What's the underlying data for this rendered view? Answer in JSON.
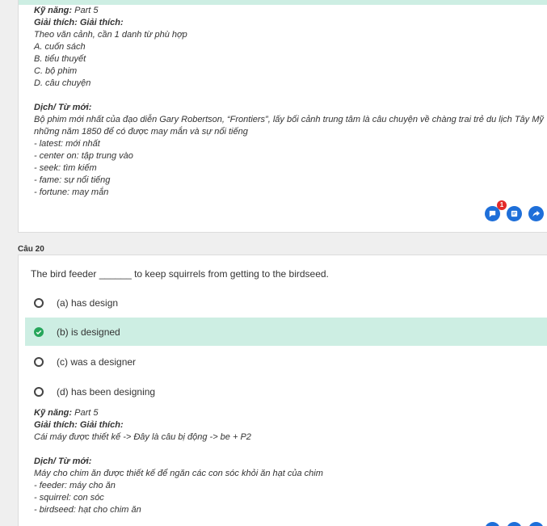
{
  "prev_question": {
    "explanation": {
      "skill_label": "Kỹ năng:",
      "skill_value": " Part 5",
      "reason_label": "Giải thích: Giải thích:",
      "lines": [
        "Theo văn cảnh, cần 1 danh từ phù hợp",
        "A. cuốn sách",
        "B. tiểu thuyết",
        "C. bộ phim",
        "D. câu chuyện"
      ],
      "translation_label": "Dịch/ Từ mới:",
      "translation": "Bộ phim mới nhất của đạo diễn Gary Robertson, “Frontiers”, lấy bối cảnh trung tâm là câu chuyện về chàng trai trẻ du lịch Tây Mỹ những năm 1850 để có được may mắn và sự nổi tiếng",
      "vocab": [
        "- latest: mới nhất",
        "- center on: tập trung vào",
        "- seek: tìm kiếm",
        "- fame: sự nổi tiếng",
        "- fortune: may mắn"
      ]
    },
    "comment_badge": "1"
  },
  "question": {
    "label": "Câu 20",
    "text": "The bird feeder ______ to keep squirrels from getting to the birdseed.",
    "options": [
      {
        "text": "(a) has design",
        "selected": false
      },
      {
        "text": "(b) is designed",
        "selected": true
      },
      {
        "text": "(c) was a designer",
        "selected": false
      },
      {
        "text": "(d) has been designing",
        "selected": false
      }
    ],
    "explanation": {
      "skill_label": "Kỹ năng:",
      "skill_value": " Part 5",
      "reason_label": "Giải thích: Giải thích:",
      "reason": "Cái máy được thiết kế -> Đây là câu bị động -> be + P2",
      "translation_label": "Dịch/ Từ mới:",
      "translation": "Máy cho chim ăn được thiết kế để ngăn các con sóc khỏi ăn hạt của chim",
      "vocab": [
        "- feeder: máy cho ăn",
        "- squirrel: con sóc",
        "- birdseed: hạt cho chim ăn"
      ]
    }
  },
  "colors": {
    "selected_bg": "#cdeee3",
    "action_blue": "#1e6fd9",
    "correct_green": "#26a65b",
    "badge_red": "#e32a2a"
  }
}
